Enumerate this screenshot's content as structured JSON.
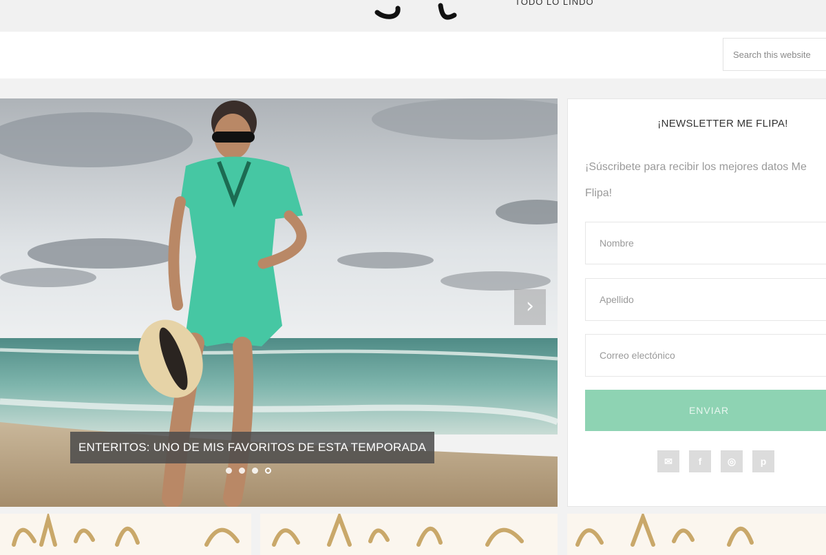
{
  "header": {
    "tagline": "TODO LO LINDO",
    "logo_name": "me-flipa-logo"
  },
  "search": {
    "placeholder": "Search this website"
  },
  "slider": {
    "caption": "ENTERITOS: UNO DE MIS FAVORITOS DE ESTA TEMPORADA",
    "next_icon": "chevron-right-icon",
    "next_glyph": "›",
    "slide_count": 4,
    "active_slide": 4
  },
  "newsletter": {
    "title": "¡NEWSLETTER ME FLIPA!",
    "description": "¡Súscribete para recibir los mejores datos Me Flipa!",
    "fields": {
      "first_name_placeholder": "Nombre",
      "last_name_placeholder": "Apellido",
      "email_placeholder": "Correo electónico"
    },
    "submit_label": "ENVIAR",
    "button_color": "#8ed3b3"
  },
  "social": {
    "icons": [
      "email-icon",
      "facebook-icon",
      "instagram-icon",
      "pinterest-icon"
    ],
    "glyphs": {
      "email": "✉",
      "facebook": "f",
      "instagram": "◎",
      "pinterest": "p"
    }
  }
}
